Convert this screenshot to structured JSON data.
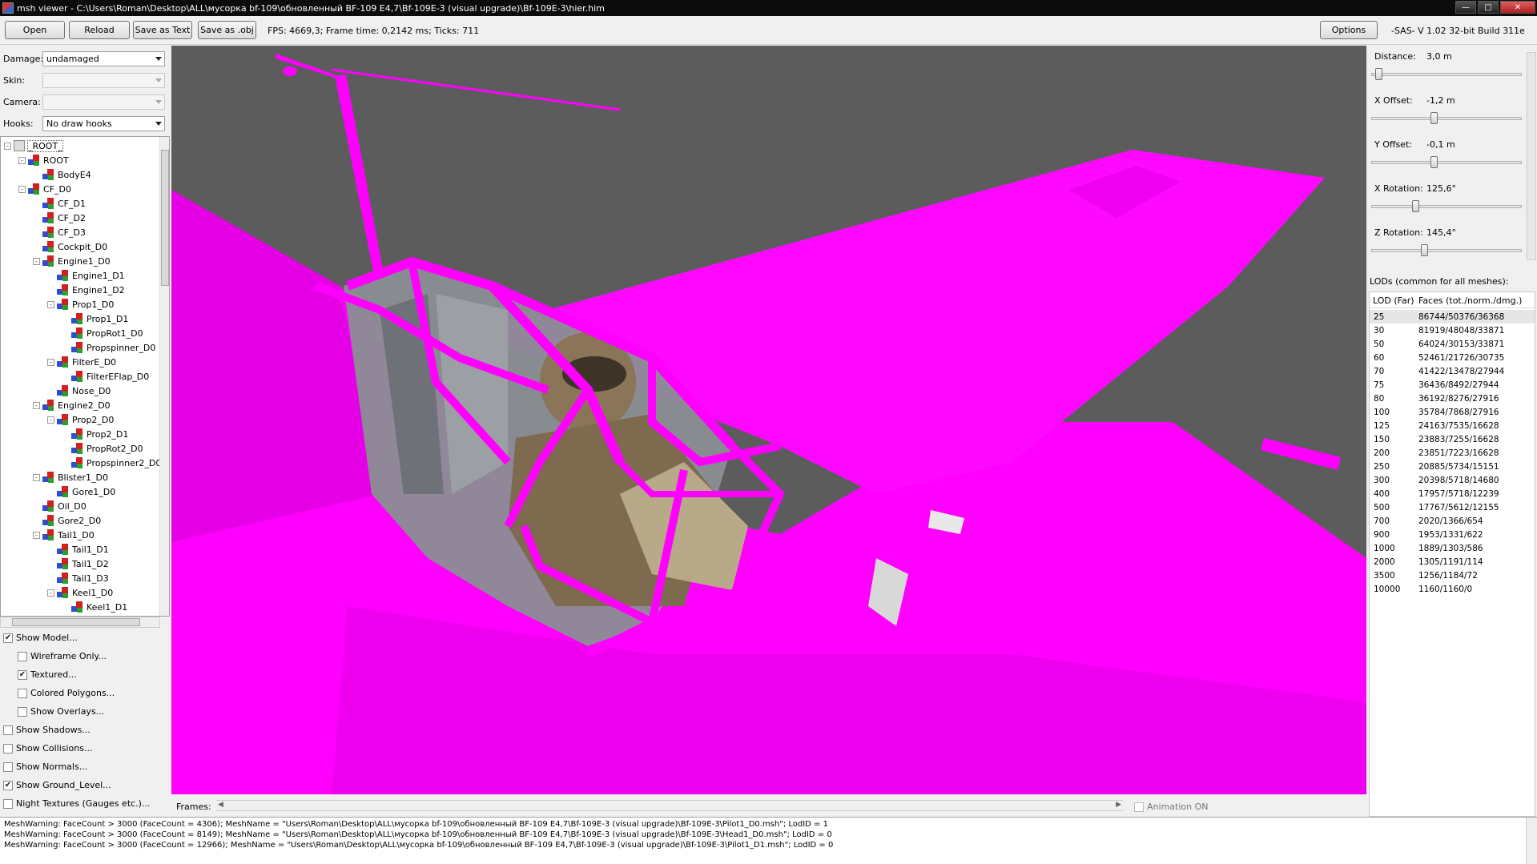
{
  "window": {
    "title": "msh viewer - C:\\Users\\Roman\\Desktop\\ALL\\мусорка bf-109\\обновленный BF-109 E4,7\\Bf-109E-3 (visual upgrade)\\Bf-109E-3\\hier.him"
  },
  "toolbar": {
    "open": "Open",
    "reload": "Reload",
    "save_text": "Save as Text",
    "save_obj": "Save as .obj",
    "fps": "FPS: 4669,3; Frame time: 0,2142 ms; Ticks: 711",
    "options": "Options",
    "version": "-SAS- V 1.02  32-bit  Build 311e"
  },
  "combos": {
    "damage_label": "Damage:",
    "damage_value": "undamaged",
    "skin_label": "Skin:",
    "skin_value": "",
    "camera_label": "Camera:",
    "camera_value": "",
    "hooks_label": "Hooks:",
    "hooks_value": "No draw hooks"
  },
  "tree": [
    {
      "label": "_ROOT_",
      "depth": 0,
      "exp": "-",
      "root": true
    },
    {
      "label": "ROOT",
      "depth": 1,
      "exp": "-"
    },
    {
      "label": "BodyE4",
      "depth": 2,
      "exp": ""
    },
    {
      "label": "CF_D0",
      "depth": 1,
      "exp": "-"
    },
    {
      "label": "CF_D1",
      "depth": 2,
      "exp": ""
    },
    {
      "label": "CF_D2",
      "depth": 2,
      "exp": ""
    },
    {
      "label": "CF_D3",
      "depth": 2,
      "exp": ""
    },
    {
      "label": "Cockpit_D0",
      "depth": 2,
      "exp": ""
    },
    {
      "label": "Engine1_D0",
      "depth": 2,
      "exp": "-"
    },
    {
      "label": "Engine1_D1",
      "depth": 3,
      "exp": ""
    },
    {
      "label": "Engine1_D2",
      "depth": 3,
      "exp": ""
    },
    {
      "label": "Prop1_D0",
      "depth": 3,
      "exp": "-"
    },
    {
      "label": "Prop1_D1",
      "depth": 4,
      "exp": ""
    },
    {
      "label": "PropRot1_D0",
      "depth": 4,
      "exp": ""
    },
    {
      "label": "Propspinner_D0",
      "depth": 4,
      "exp": ""
    },
    {
      "label": "FilterE_D0",
      "depth": 3,
      "exp": "-"
    },
    {
      "label": "FilterEFlap_D0",
      "depth": 4,
      "exp": ""
    },
    {
      "label": "Nose_D0",
      "depth": 3,
      "exp": ""
    },
    {
      "label": "Engine2_D0",
      "depth": 2,
      "exp": "-"
    },
    {
      "label": "Prop2_D0",
      "depth": 3,
      "exp": "-"
    },
    {
      "label": "Prop2_D1",
      "depth": 4,
      "exp": ""
    },
    {
      "label": "PropRot2_D0",
      "depth": 4,
      "exp": ""
    },
    {
      "label": "Propspinner2_D0",
      "depth": 4,
      "exp": ""
    },
    {
      "label": "Blister1_D0",
      "depth": 2,
      "exp": "-"
    },
    {
      "label": "Gore1_D0",
      "depth": 3,
      "exp": ""
    },
    {
      "label": "Oil_D0",
      "depth": 2,
      "exp": ""
    },
    {
      "label": "Gore2_D0",
      "depth": 2,
      "exp": ""
    },
    {
      "label": "Tail1_D0",
      "depth": 2,
      "exp": "-"
    },
    {
      "label": "Tail1_D1",
      "depth": 3,
      "exp": ""
    },
    {
      "label": "Tail1_D2",
      "depth": 3,
      "exp": ""
    },
    {
      "label": "Tail1_D3",
      "depth": 3,
      "exp": ""
    },
    {
      "label": "Keel1_D0",
      "depth": 3,
      "exp": "-"
    },
    {
      "label": "Keel1_D1",
      "depth": 4,
      "exp": ""
    }
  ],
  "checkboxes": [
    {
      "label": "Show Model...",
      "checked": true,
      "indent": false
    },
    {
      "label": "Wireframe Only...",
      "checked": false,
      "indent": true
    },
    {
      "label": "Textured...",
      "checked": true,
      "indent": true
    },
    {
      "label": "Colored Polygons...",
      "checked": false,
      "indent": true
    },
    {
      "label": "Show Overlays...",
      "checked": false,
      "indent": true
    },
    {
      "label": "Show Shadows...",
      "checked": false,
      "indent": false
    },
    {
      "label": "Show Collisions...",
      "checked": false,
      "indent": false
    },
    {
      "label": "Show Normals...",
      "checked": false,
      "indent": false
    },
    {
      "label": "Show Ground_Level...",
      "checked": true,
      "indent": false
    },
    {
      "label": "Night Textures (Gauges etc.)...",
      "checked": false,
      "indent": false
    }
  ],
  "sliders": [
    {
      "label": "Distance:",
      "value": "3,0 m",
      "level": 0.02
    },
    {
      "label": "X Offset:",
      "value": "-1,2 m",
      "level": 0.41
    },
    {
      "label": "Y Offset:",
      "value": "-0,1 m",
      "level": 0.41
    },
    {
      "label": "X Rotation:",
      "value": "125,6°",
      "level": 0.28
    },
    {
      "label": "Z Rotation:",
      "value": "145,4°",
      "level": 0.34
    }
  ],
  "lod": {
    "title": "LODs (common for all meshes):",
    "col1": "LOD (Far)",
    "col2": "Faces (tot./norm./dmg.)",
    "rows": [
      [
        "25",
        "86744/50376/36368"
      ],
      [
        "30",
        "81919/48048/33871"
      ],
      [
        "50",
        "64024/30153/33871"
      ],
      [
        "60",
        "52461/21726/30735"
      ],
      [
        "70",
        "41422/13478/27944"
      ],
      [
        "75",
        "36436/8492/27944"
      ],
      [
        "80",
        "36192/8276/27916"
      ],
      [
        "100",
        "35784/7868/27916"
      ],
      [
        "125",
        "24163/7535/16628"
      ],
      [
        "150",
        "23883/7255/16628"
      ],
      [
        "200",
        "23851/7223/16628"
      ],
      [
        "250",
        "20885/5734/15151"
      ],
      [
        "300",
        "20398/5718/14680"
      ],
      [
        "400",
        "17957/5718/12239"
      ],
      [
        "500",
        "17767/5612/12155"
      ],
      [
        "700",
        "2020/1366/654"
      ],
      [
        "900",
        "1953/1331/622"
      ],
      [
        "1000",
        "1889/1303/586"
      ],
      [
        "2000",
        "1305/1191/114"
      ],
      [
        "3500",
        "1256/1184/72"
      ],
      [
        "10000",
        "1160/1160/0"
      ]
    ]
  },
  "frames": {
    "label": "Frames:",
    "animation": "Animation ON"
  },
  "log": [
    "MeshWarning: FaceCount > 3000 (FaceCount = 4306); MeshName = \"Users\\Roman\\Desktop\\ALL\\мусорка bf-109\\обновленный BF-109 E4,7\\Bf-109E-3 (visual upgrade)\\Bf-109E-3\\Pilot1_D0.msh\"; LodID = 1",
    "MeshWarning: FaceCount > 3000 (FaceCount = 8149); MeshName = \"Users\\Roman\\Desktop\\ALL\\мусорка bf-109\\обновленный BF-109 E4,7\\Bf-109E-3 (visual upgrade)\\Bf-109E-3\\Head1_D0.msh\"; LodID = 0",
    "MeshWarning: FaceCount > 3000 (FaceCount = 12966); MeshName = \"Users\\Roman\\Desktop\\ALL\\мусорка bf-109\\обновленный BF-109 E4,7\\Bf-109E-3 (visual upgrade)\\Bf-109E-3\\Pilot1_D1.msh\"; LodID = 0"
  ],
  "colors": {
    "mesh": "#ff00ff",
    "viewport_bg": "#5a5a5a"
  }
}
